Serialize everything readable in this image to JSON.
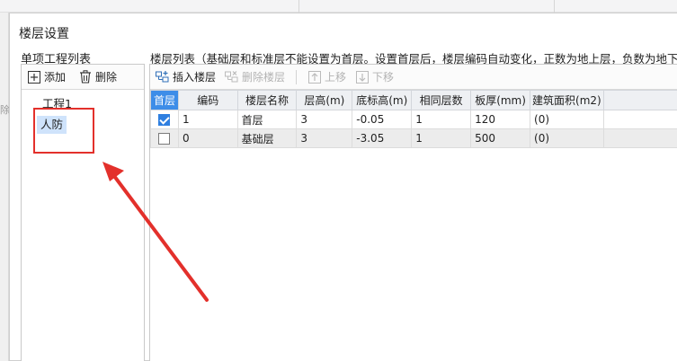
{
  "background": {
    "side_chip": "除"
  },
  "dialog": {
    "title": "楼层设置"
  },
  "left": {
    "caption": "单项工程列表",
    "toolbar": {
      "add_label": "添加",
      "delete_label": "删除"
    },
    "tree": [
      {
        "label": "工程1"
      },
      {
        "label": "人防",
        "selected": true
      }
    ]
  },
  "right": {
    "caption": "楼层列表（基础层和标准层不能设置为首层。设置首层后，楼层编码自动变化，正数为地上层，负数为地下层，",
    "toolbar": {
      "insert_label": "插入楼层",
      "delete_label": "删除楼层",
      "up_label": "上移",
      "down_label": "下移"
    },
    "table": {
      "headers": [
        "首层",
        "编码",
        "楼层名称",
        "层高(m)",
        "底标高(m)",
        "相同层数",
        "板厚(mm)",
        "建筑面积(m2)"
      ],
      "rows": [
        {
          "first_floor": true,
          "code": "1",
          "name": "首层",
          "height": "3",
          "bottom_elev": "-0.05",
          "same_count": "1",
          "slab": "120",
          "area": "(0)"
        },
        {
          "first_floor": false,
          "code": "0",
          "name": "基础层",
          "height": "3",
          "bottom_elev": "-3.05",
          "same_count": "1",
          "slab": "500",
          "area": "(0)"
        }
      ]
    }
  },
  "colors": {
    "accent": "#3d8de8",
    "selection": "#cfe3fb",
    "annotation": "#e3302b"
  }
}
